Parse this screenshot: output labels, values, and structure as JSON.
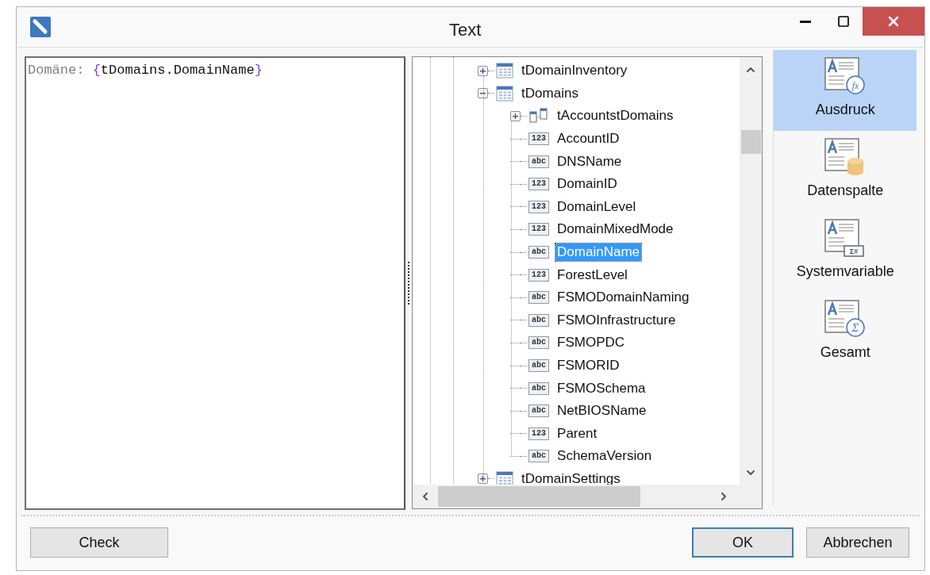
{
  "window": {
    "title": "Text"
  },
  "editor": {
    "prefix": "Domäne: ",
    "open": "{",
    "field": "tDomains.DomainName",
    "close": "}"
  },
  "tree": [
    {
      "label": "tDomainInventory",
      "kind": "table",
      "expanded": false,
      "selected": false
    },
    {
      "label": "tDomains",
      "kind": "table",
      "expanded": true,
      "selected": false,
      "children": [
        {
          "label": "tAccountstDomains",
          "kind": "relation",
          "expanded": false,
          "selected": false
        },
        {
          "label": "AccountID",
          "kind": "field",
          "badge": "123",
          "selected": false
        },
        {
          "label": "DNSName",
          "kind": "field",
          "badge": "abc",
          "selected": false
        },
        {
          "label": "DomainID",
          "kind": "field",
          "badge": "123",
          "selected": false
        },
        {
          "label": "DomainLevel",
          "kind": "field",
          "badge": "123",
          "selected": false
        },
        {
          "label": "DomainMixedMode",
          "kind": "field",
          "badge": "123",
          "selected": false
        },
        {
          "label": "DomainName",
          "kind": "field",
          "badge": "abc",
          "selected": true
        },
        {
          "label": "ForestLevel",
          "kind": "field",
          "badge": "123",
          "selected": false
        },
        {
          "label": "FSMODomainNaming",
          "kind": "field",
          "badge": "abc",
          "selected": false
        },
        {
          "label": "FSMOInfrastructure",
          "kind": "field",
          "badge": "abc",
          "selected": false
        },
        {
          "label": "FSMOPDC",
          "kind": "field",
          "badge": "abc",
          "selected": false
        },
        {
          "label": "FSMORID",
          "kind": "field",
          "badge": "abc",
          "selected": false
        },
        {
          "label": "FSMOSchema",
          "kind": "field",
          "badge": "abc",
          "selected": false
        },
        {
          "label": "NetBIOSName",
          "kind": "field",
          "badge": "abc",
          "selected": false
        },
        {
          "label": "Parent",
          "kind": "field",
          "badge": "123",
          "selected": false
        },
        {
          "label": "SchemaVersion",
          "kind": "field",
          "badge": "abc",
          "selected": false
        }
      ]
    },
    {
      "label": "tDomainSettings",
      "kind": "table",
      "expanded": false,
      "selected": false
    }
  ],
  "sidebar": {
    "items": [
      {
        "label": "Ausdruck",
        "kind": "expression",
        "badge": "fx",
        "selected": true
      },
      {
        "label": "Datenspalte",
        "kind": "column",
        "selected": false
      },
      {
        "label": "Systemvariable",
        "kind": "system",
        "badge": "Σ#",
        "selected": false
      },
      {
        "label": "Gesamt",
        "kind": "total",
        "badge": "Σ",
        "selected": false
      }
    ]
  },
  "buttons": {
    "left": [
      "Check"
    ],
    "right": [
      {
        "label": "OK",
        "default": true
      },
      {
        "label": "Abbrechen",
        "default": false
      }
    ]
  }
}
